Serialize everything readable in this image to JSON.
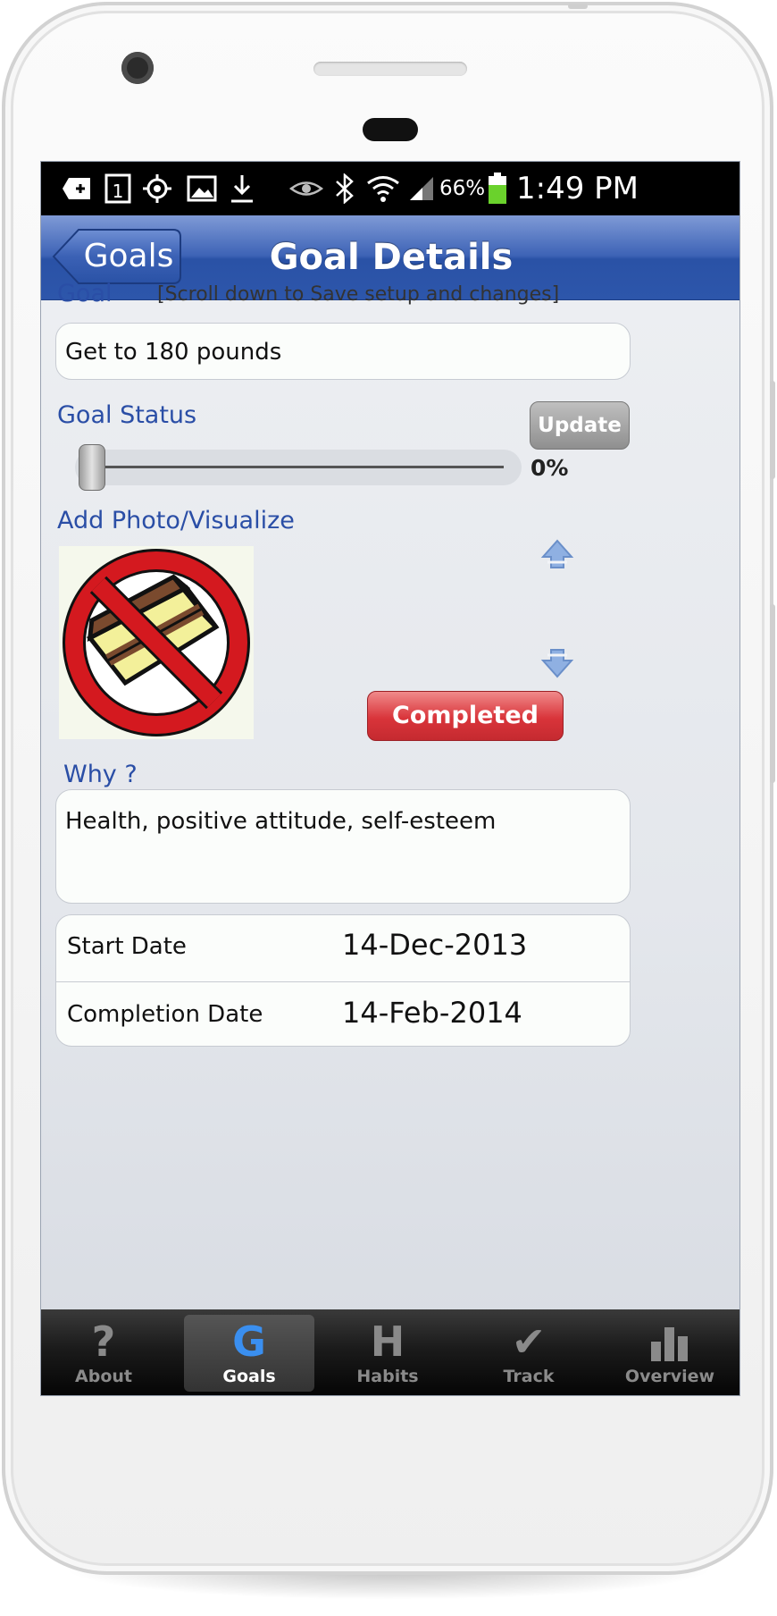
{
  "status_bar": {
    "battery": "66%",
    "time": "1:49 PM",
    "sim_indicator": "1",
    "icons": [
      "add-notification-icon",
      "sim-icon",
      "location-icon",
      "image-icon",
      "download-icon",
      "eye-icon",
      "bluetooth-icon",
      "wifi-icon",
      "signal-icon",
      "battery-icon"
    ]
  },
  "nav": {
    "back_label": "Goals",
    "title": "Goal Details"
  },
  "goal": {
    "label": "Goal",
    "hint": "[Scroll down to Save setup and changes]",
    "value": "Get to 180 pounds"
  },
  "status": {
    "label": "Goal Status",
    "update_label": "Update",
    "percent": "0%",
    "slider_value": 0
  },
  "photo": {
    "label": "Add Photo/Visualize",
    "image_name": "no-cake-image"
  },
  "buttons": {
    "completed_label": "Completed"
  },
  "why": {
    "label": "Why ?",
    "value": "Health, positive attitude, self-esteem"
  },
  "dates": {
    "start_label": "Start Date",
    "start_value": "14-Dec-2013",
    "completion_label": "Completion Date",
    "completion_value": "14-Feb-2014"
  },
  "tabs": [
    {
      "label": "About",
      "glyph": "?",
      "icon": "question-icon",
      "active": false
    },
    {
      "label": "Goals",
      "glyph": "G",
      "icon": "goals-icon",
      "active": true
    },
    {
      "label": "Habits",
      "glyph": "H",
      "icon": "habits-icon",
      "active": false
    },
    {
      "label": "Track",
      "glyph": "✔",
      "icon": "checkmark-icon",
      "active": false
    },
    {
      "label": "Overview",
      "glyph": "",
      "icon": "bar-chart-icon",
      "active": false
    }
  ],
  "colors": {
    "nav_blue": "#2d56ab",
    "label_blue": "#2a4ea6",
    "completed_red": "#d9343a",
    "active_tab_blue": "#3a8ff0"
  }
}
